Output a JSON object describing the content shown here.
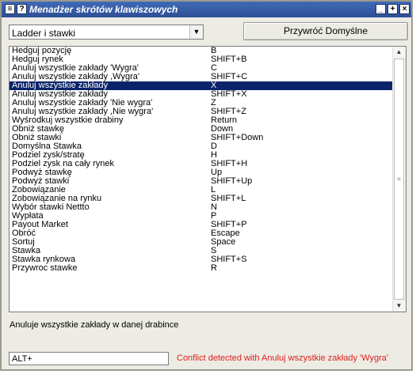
{
  "window": {
    "title": "Menadżer skrótów klawiszowych",
    "help_glyph": "?",
    "menu_glyph": "≡",
    "minimize_glyph": "_",
    "maximize_glyph": "+",
    "close_glyph": "×"
  },
  "toolbar": {
    "dropdown_value": "Ladder i stawki",
    "dropdown_arrow": "▼",
    "reset_label": "Przywróć Domyślne"
  },
  "shortcuts": [
    {
      "action": "Hedguj pozycję",
      "key": "B"
    },
    {
      "action": "Hedguj rynek",
      "key": "SHIFT+B"
    },
    {
      "action": "Anuluj wszystkie zakłady 'Wygra'",
      "key": "C"
    },
    {
      "action": "Anuluj wszystkie zakłady ,Wygra'",
      "key": "SHIFT+C"
    },
    {
      "action": "Anuluj wszystkie zakłady",
      "key": "X"
    },
    {
      "action": "Anuluj wszystkie zakłady",
      "key": "SHIFT+X"
    },
    {
      "action": "Anuluj wszystkie zakłady 'Nie wygra'",
      "key": "Z"
    },
    {
      "action": "Anuluj wszystkie zakłady ,Nie wygra'",
      "key": "SHIFT+Z"
    },
    {
      "action": "Wyśrodkuj wszystkie drabiny",
      "key": "Return"
    },
    {
      "action": "Obniż stawkę",
      "key": "Down"
    },
    {
      "action": "Obniż stawki",
      "key": "SHIFT+Down"
    },
    {
      "action": "Domyślna Stawka",
      "key": "D"
    },
    {
      "action": "Podziel zysk/stratę",
      "key": "H"
    },
    {
      "action": "Podziel zysk na cały rynek",
      "key": "SHIFT+H"
    },
    {
      "action": "Podwyż stawkę",
      "key": "Up"
    },
    {
      "action": "Podwyż stawki",
      "key": "SHIFT+Up"
    },
    {
      "action": "Zobowiązanie",
      "key": "L"
    },
    {
      "action": "Zobowiązanie na rynku",
      "key": "SHIFT+L"
    },
    {
      "action": "Wybór stawki Nettto",
      "key": "N"
    },
    {
      "action": "Wypłata",
      "key": "P"
    },
    {
      "action": "Payout Market",
      "key": "SHIFT+P"
    },
    {
      "action": "Obróć",
      "key": "Escape"
    },
    {
      "action": "Sortuj",
      "key": "Space"
    },
    {
      "action": "Stawka",
      "key": "S"
    },
    {
      "action": "Stawka rynkowa",
      "key": "SHIFT+S"
    },
    {
      "action": "Przywroc stawke",
      "key": "R"
    }
  ],
  "selected_index": 4,
  "scrollbar": {
    "up_glyph": "▲",
    "down_glyph": "▼",
    "grip_glyph": "≡"
  },
  "description": "Anuluje wszystkie zakłady w danej drabince",
  "key_input_value": "ALT+",
  "conflict_message": "Conflict detected with Anuluj wszystkie zakłady 'Wygra'"
}
